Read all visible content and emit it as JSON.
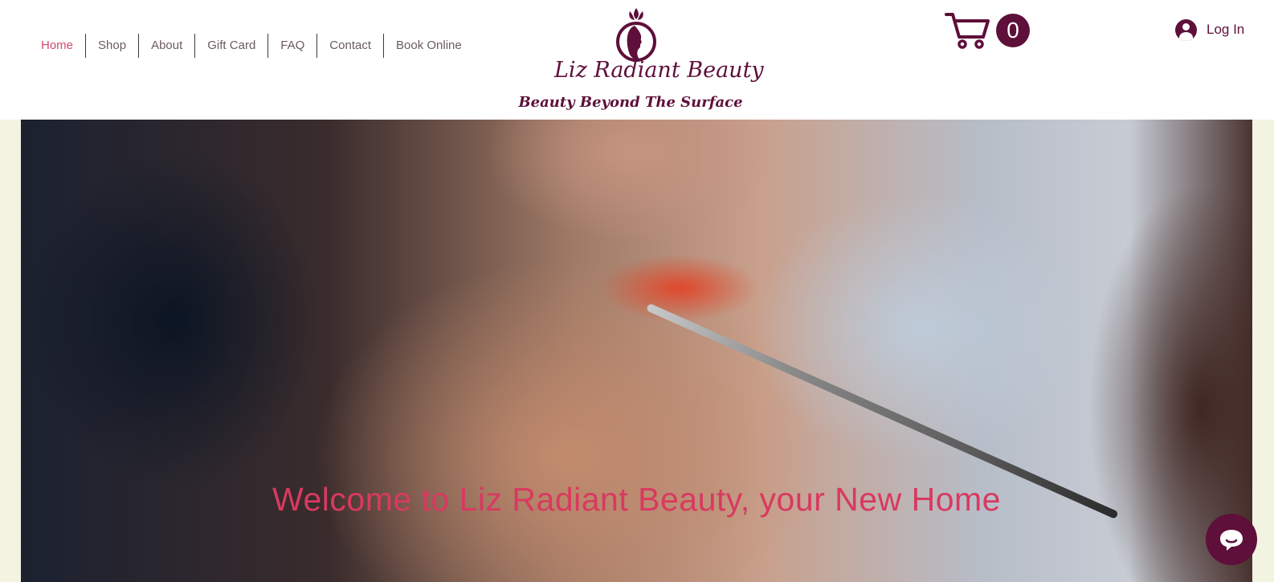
{
  "nav": {
    "items": [
      {
        "label": "Home",
        "active": true
      },
      {
        "label": "Shop"
      },
      {
        "label": "About"
      },
      {
        "label": "Gift Card"
      },
      {
        "label": "FAQ"
      },
      {
        "label": "Contact"
      },
      {
        "label": "Book Online"
      }
    ]
  },
  "brand": {
    "name": "Liz Radiant Beauty",
    "tagline": "Beauty Beyond The Surface",
    "logo_icon": "woman-profile-logo-icon",
    "color": "#5e0f3a"
  },
  "cart": {
    "icon": "cart-icon",
    "count": "0"
  },
  "login": {
    "icon": "user-avatar-icon",
    "label": "Log In"
  },
  "hero": {
    "title": "Welcome to Liz Radiant Beauty, your New Home",
    "title_color": "#d9395f"
  },
  "chat": {
    "icon": "chat-bubble-icon"
  }
}
